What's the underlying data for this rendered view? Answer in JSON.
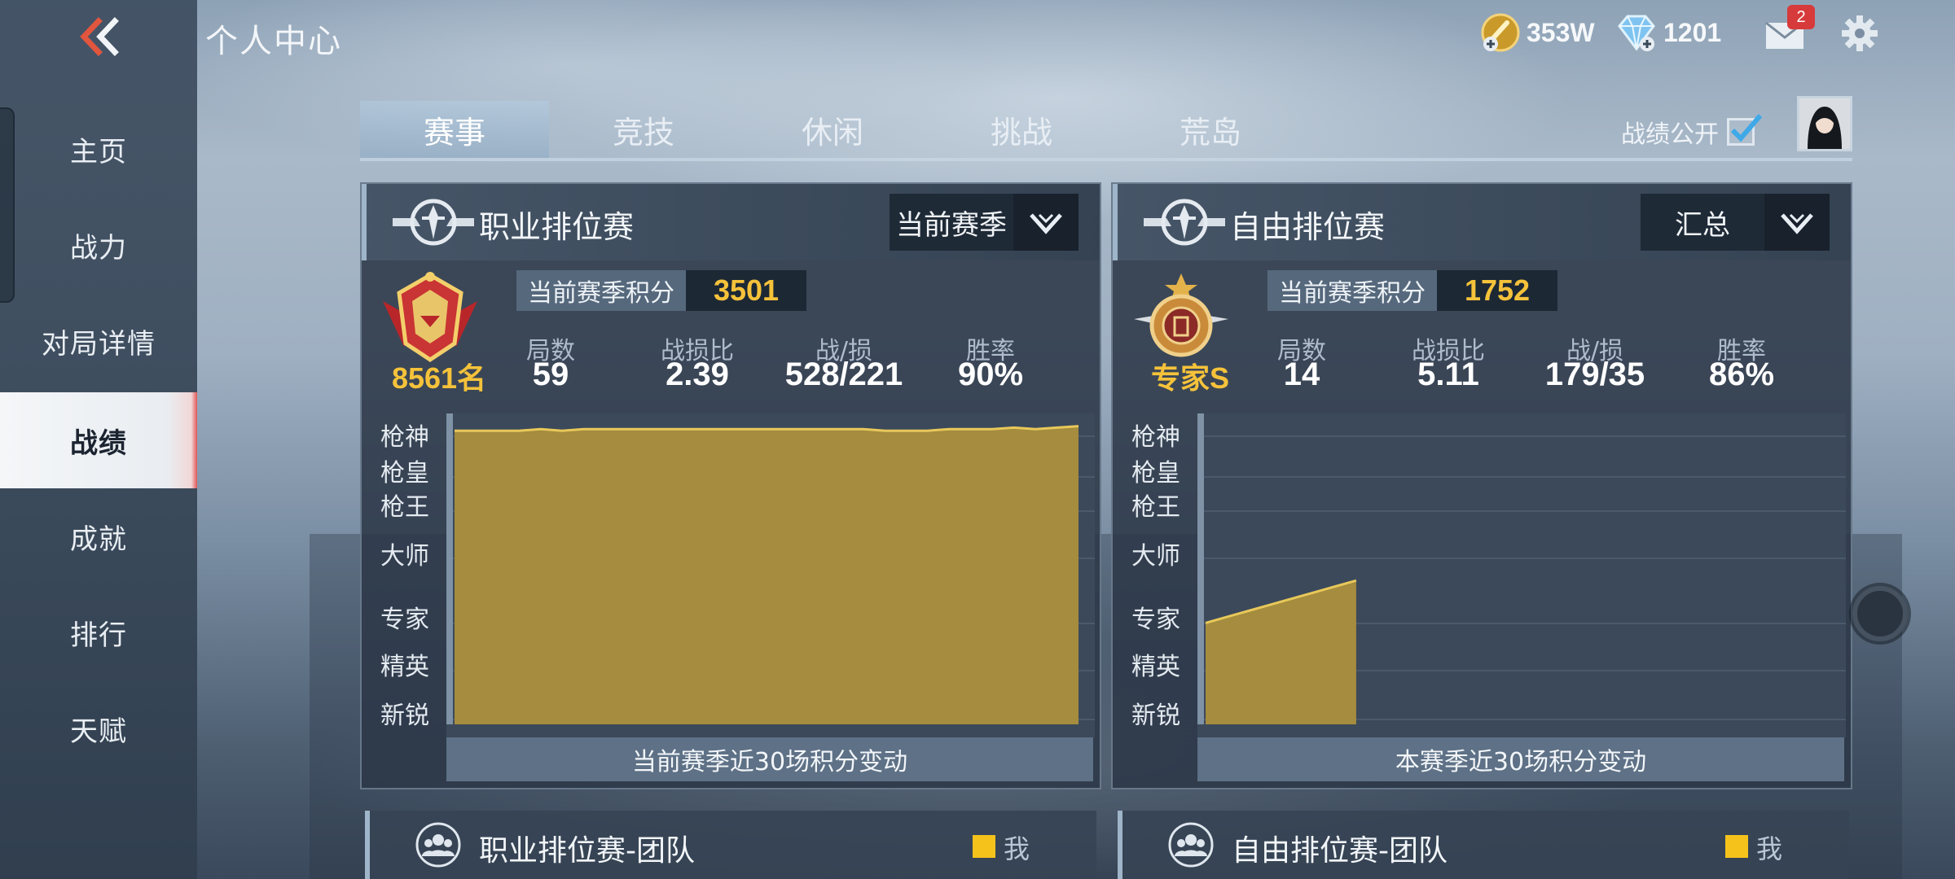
{
  "header": {
    "title": "个人中心",
    "gold": "353W",
    "diamonds": "1201",
    "mail_count": "2"
  },
  "sidebar": {
    "items": [
      {
        "label": "主页"
      },
      {
        "label": "战力"
      },
      {
        "label": "对局详情"
      },
      {
        "label": "战绩",
        "active": true
      },
      {
        "label": "成就"
      },
      {
        "label": "排行"
      },
      {
        "label": "天赋"
      }
    ]
  },
  "tabs": [
    {
      "label": "赛事",
      "active": true
    },
    {
      "label": "竞技"
    },
    {
      "label": "休闲"
    },
    {
      "label": "挑战"
    },
    {
      "label": "荒岛"
    }
  ],
  "public_toggle": {
    "label": "战绩公开",
    "checked": true
  },
  "panels": {
    "pro": {
      "title": "职业排位赛",
      "filter": "当前赛季",
      "rank": "8561名",
      "score_label": "当前赛季积分",
      "score": "3501",
      "stats": [
        {
          "label": "局数",
          "value": "59"
        },
        {
          "label": "战损比",
          "value": "2.39"
        },
        {
          "label": "战/损",
          "value": "528/221"
        },
        {
          "label": "胜率",
          "value": "90%"
        }
      ],
      "caption": "当前赛季近30场积分变动"
    },
    "free": {
      "title": "自由排位赛",
      "filter": "汇总",
      "rank": "专家S",
      "score_label": "当前赛季积分",
      "score": "1752",
      "stats": [
        {
          "label": "局数",
          "value": "14"
        },
        {
          "label": "战损比",
          "value": "5.11"
        },
        {
          "label": "战/损",
          "value": "179/35"
        },
        {
          "label": "胜率",
          "value": "86%"
        }
      ],
      "caption": "本赛季近30场积分变动"
    }
  },
  "tiers": [
    "枪神",
    "枪皇",
    "枪王",
    "大师",
    "专家",
    "精英",
    "新锐"
  ],
  "chart_data": [
    {
      "type": "area",
      "title": "当前赛季近30场积分变动",
      "y_tiers": [
        "枪神",
        "枪皇",
        "枪王",
        "大师",
        "专家",
        "精英",
        "新锐"
      ],
      "note": "values normalized 0-1 relative to tier axis",
      "values": [
        0.97,
        0.97,
        0.97,
        0.97,
        0.975,
        0.97,
        0.975,
        0.975,
        0.975,
        0.975,
        0.975,
        0.975,
        0.975,
        0.975,
        0.975,
        0.975,
        0.975,
        0.975,
        0.975,
        0.975,
        0.97,
        0.97,
        0.97,
        0.975,
        0.975,
        0.975,
        0.98,
        0.975,
        0.98,
        0.985
      ],
      "color": "#a58c3e"
    },
    {
      "type": "area",
      "title": "本赛季近30场积分变动",
      "y_tiers": [
        "枪神",
        "枪皇",
        "枪王",
        "大师",
        "专家",
        "精英",
        "新锐"
      ],
      "note": "values normalized 0-1 relative to tier axis",
      "values": [
        0.335,
        0.355,
        0.375,
        0.395,
        0.415,
        0.435,
        0.455,
        0.475
      ],
      "slots": 30,
      "color": "#a58c3e"
    }
  ],
  "team": {
    "pro_title": "职业排位赛-团队",
    "free_title": "自由排位赛-团队",
    "legend_me": "我"
  },
  "colors": {
    "accent_gold": "#f5c23a",
    "area_fill": "#a58c3e",
    "active_nav_edge": "#e05555"
  }
}
